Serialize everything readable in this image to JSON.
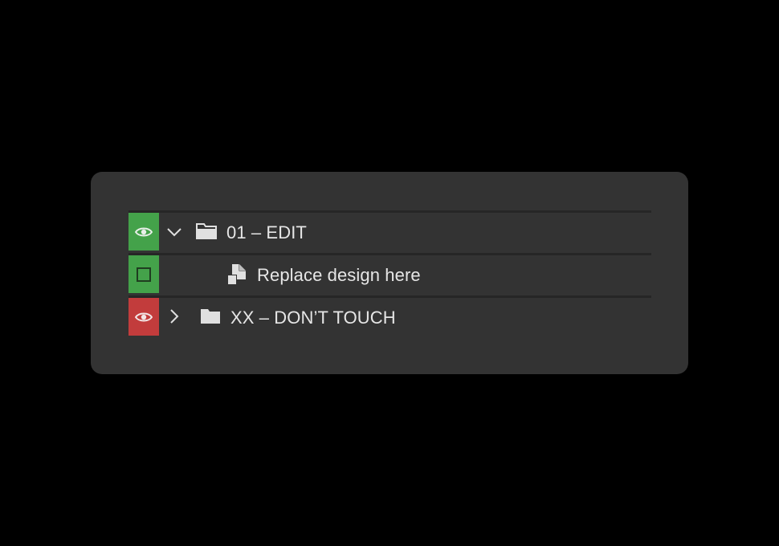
{
  "colors": {
    "background": "#000000",
    "panel": "#333333",
    "divider": "#262626",
    "visible_green": "#44a24a",
    "locked_red": "#c23c3c",
    "text": "#e6e6e6"
  },
  "layers": [
    {
      "name": "01 – EDIT",
      "type": "folder",
      "expanded": true,
      "visibility_icon": "eye-icon",
      "visibility_color": "#44a24a",
      "chevron_icon": "chevron-down-icon",
      "folder_icon": "folder-open-icon"
    },
    {
      "name": "Replace design here",
      "type": "smart-object",
      "visibility_icon": "square-icon",
      "visibility_color": "#44a24a",
      "layer_icon": "smart-object-icon"
    },
    {
      "name": "XX – DON’T TOUCH",
      "type": "folder",
      "expanded": false,
      "visibility_icon": "eye-icon",
      "visibility_color": "#c23c3c",
      "chevron_icon": "chevron-right-icon",
      "folder_icon": "folder-closed-icon"
    }
  ]
}
